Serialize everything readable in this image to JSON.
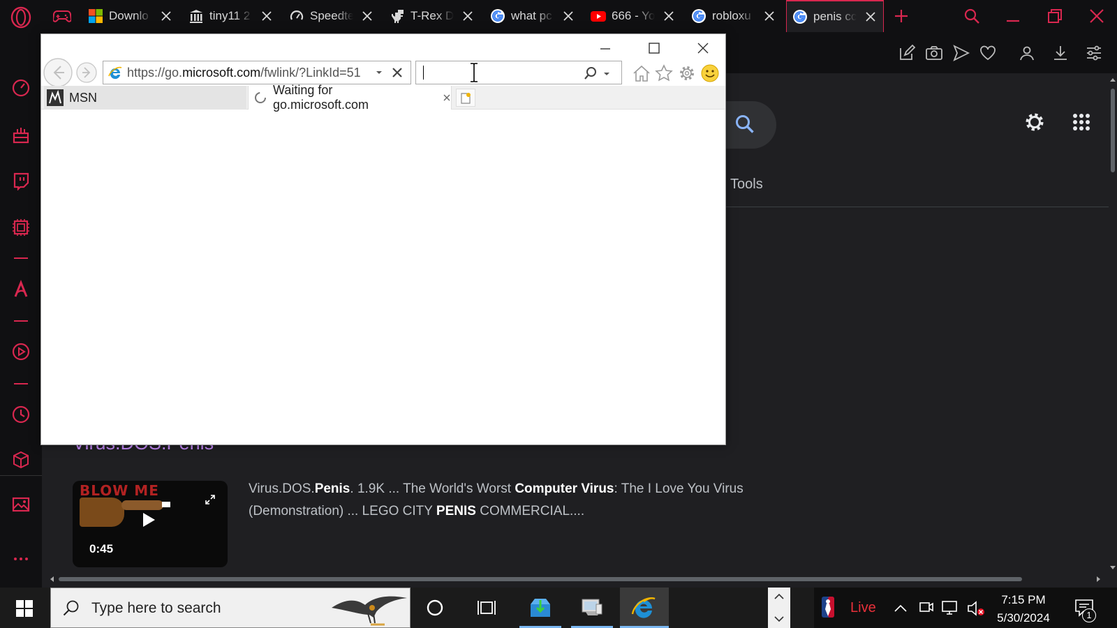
{
  "opera": {
    "tabs": [
      {
        "label": "Downlo",
        "icon": "microsoft-logo-icon"
      },
      {
        "label": "tiny11 2",
        "icon": "bank-icon"
      },
      {
        "label": "Speedte",
        "icon": "speedometer-icon"
      },
      {
        "label": "T-Rex D",
        "icon": "dinosaur-icon"
      },
      {
        "label": "what pc",
        "icon": "google-g-icon"
      },
      {
        "label": "666 - Yo",
        "icon": "youtube-icon"
      },
      {
        "label": "robloxu",
        "icon": "google-g-icon"
      },
      {
        "label": "penis cc",
        "icon": "google-g-icon"
      }
    ],
    "accent_color": "#d8274f"
  },
  "ie": {
    "address_url": "https://go.microsoft.com/fwlink/?LinkId=51",
    "address_prefix": "https://go.",
    "address_domain": "microsoft.com",
    "address_suffix": "/fwlink/?LinkId=51",
    "tabs": [
      {
        "label": "MSN"
      },
      {
        "label": "Waiting for go.microsoft.com"
      }
    ]
  },
  "page": {
    "tools_label": "Tools",
    "result_title": "Virus.DOS.Penis",
    "video_duration": "0:45",
    "thumbnail_text": "BLOW ME",
    "snippet": [
      {
        "text": "Virus.DOS.",
        "bold": false
      },
      {
        "text": "Penis",
        "bold": true
      },
      {
        "text": ". 1.9K ... The World's Worst ",
        "bold": false
      },
      {
        "text": "Computer Virus",
        "bold": true
      },
      {
        "text": ": The I Love You Virus (Demonstration) ... LEGO CITY ",
        "bold": false
      },
      {
        "text": "PENIS",
        "bold": true
      },
      {
        "text": " COMMERCIAL....",
        "bold": false
      }
    ]
  },
  "taskbar": {
    "search_placeholder": "Type here to search",
    "live_label": "Live",
    "time": "7:15 PM",
    "date": "5/30/2024",
    "notification_count": "1"
  }
}
